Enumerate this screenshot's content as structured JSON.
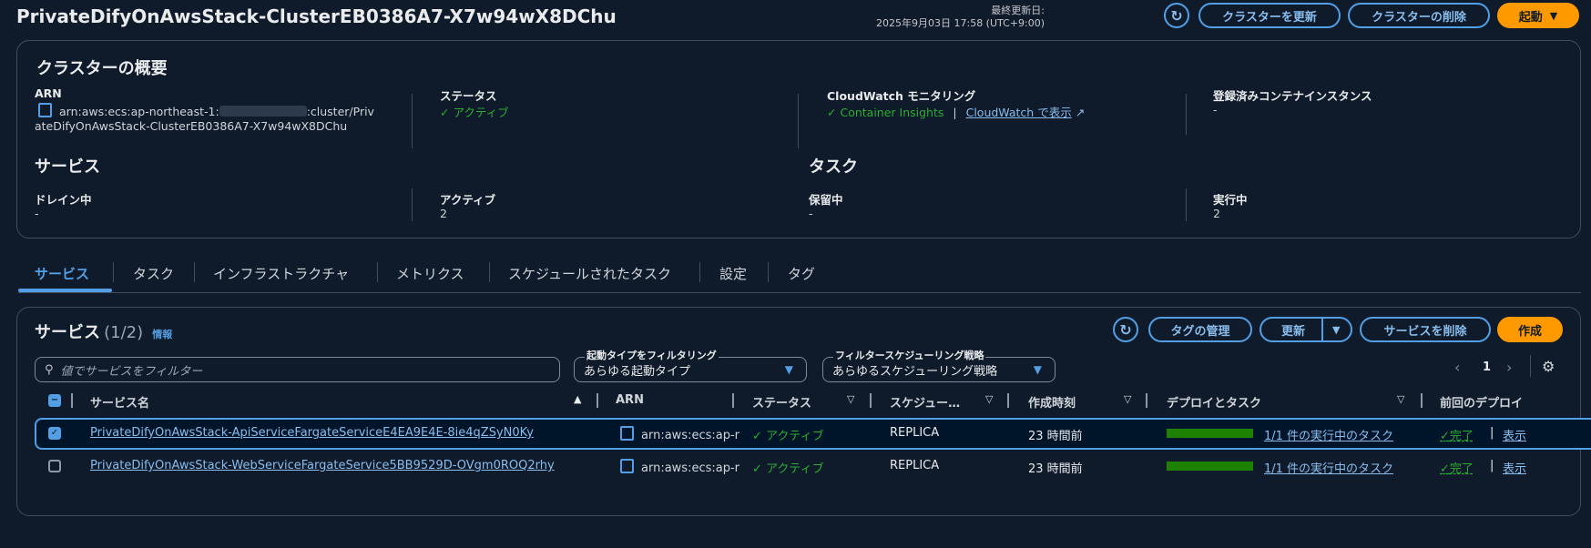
{
  "header": {
    "title": "PrivateDifyOnAwsStack-ClusterEB0386A7-X7w94wX8DChu",
    "last_updated_label": "最終更新日:",
    "last_updated_time": "2025年9月03日 17:58 (UTC+9:00)",
    "update_cluster": "クラスターを更新",
    "delete_cluster": "クラスターの削除",
    "launch": "起動"
  },
  "overview": {
    "title": "クラスターの概要",
    "arn_label": "ARN",
    "arn_line1_pre": "arn:aws:ecs:ap-northeast-1:",
    "arn_line1_post": ":cluster/Priv",
    "arn_line2": "ateDifyOnAwsStack-ClusterEB0386A7-X7w94wX8DChu",
    "status_label": "ステータス",
    "status_value": "アクティブ",
    "cw_label": "CloudWatch モニタリング",
    "cw_insights": "Container Insights",
    "cw_link": "CloudWatch で表示",
    "instances_label": "登録済みコンテナインスタンス",
    "instances_value": "-",
    "services_title": "サービス",
    "draining_label": "ドレイン中",
    "draining_value": "-",
    "active_label": "アクティブ",
    "active_value": "2",
    "tasks_title": "タスク",
    "pending_label": "保留中",
    "pending_value": "-",
    "running_label": "実行中",
    "running_value": "2"
  },
  "tabs": [
    "サービス",
    "タスク",
    "インフラストラクチャ",
    "メトリクス",
    "スケジュールされたタスク",
    "設定",
    "タグ"
  ],
  "services": {
    "title": "サービス",
    "count": "(1/2)",
    "info": "情報",
    "manage_tags": "タグの管理",
    "update": "更新",
    "delete": "サービスを削除",
    "create": "作成",
    "search_placeholder": "値でサービスをフィルター",
    "launch_filter_label": "起動タイプをフィルタリング",
    "launch_filter_value": "あらゆる起動タイプ",
    "sched_filter_label": "フィルタースケジューリング戦略",
    "sched_filter_value": "あらゆるスケジューリング戦略",
    "page": "1",
    "columns": [
      "サービス名",
      "ARN",
      "ステータス",
      "スケジュー…",
      "作成時刻",
      "デプロイとタスク",
      "前回のデプロイ"
    ],
    "rows": [
      {
        "name": "PrivateDifyOnAwsStack-ApiServiceFargateServiceE4EA9E4E-8ie4qZSyN0Ky",
        "arn": "arn:aws:ecs:ap-r",
        "status": "アクティブ",
        "scheduling": "REPLICA",
        "created": "23 時間前",
        "tasks": "1/1 件の実行中のタスク",
        "tasks_progress": 1.0,
        "deploy": "完了",
        "view": "表示",
        "selected": true
      },
      {
        "name": "PrivateDifyOnAwsStack-WebServiceFargateService5BB9529D-OVgm0ROQ2rhy",
        "arn": "arn:aws:ecs:ap-r",
        "status": "アクティブ",
        "scheduling": "REPLICA",
        "created": "23 時間前",
        "tasks": "1/1 件の実行中のタスク",
        "tasks_progress": 1.0,
        "deploy": "完了",
        "view": "表示",
        "selected": false
      }
    ]
  },
  "colors": {
    "accent": "#539fe5",
    "primary": "#ff9900",
    "success": "#29ad32",
    "background": "#0f1b2a"
  }
}
